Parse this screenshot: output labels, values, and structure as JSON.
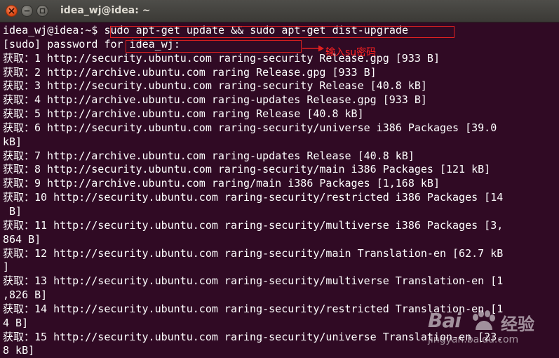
{
  "window": {
    "title": "idea_wj@idea: ~"
  },
  "terminal": {
    "lines": [
      "idea_wj@idea:~$ sudo apt-get update && sudo apt-get dist-upgrade",
      "[sudo] password for idea_wj:",
      "获取：1 http://security.ubuntu.com raring-security Release.gpg [933 B]",
      "获取：2 http://archive.ubuntu.com raring Release.gpg [933 B]",
      "获取：3 http://security.ubuntu.com raring-security Release [40.8 kB]",
      "获取：4 http://archive.ubuntu.com raring-updates Release.gpg [933 B]",
      "获取：5 http://archive.ubuntu.com raring Release [40.8 kB]",
      "获取：6 http://security.ubuntu.com raring-security/universe i386 Packages [39.0",
      "kB]",
      "获取：7 http://archive.ubuntu.com raring-updates Release [40.8 kB]",
      "获取：8 http://security.ubuntu.com raring-security/main i386 Packages [121 kB]",
      "获取：9 http://archive.ubuntu.com raring/main i386 Packages [1,168 kB]",
      "获取：10 http://security.ubuntu.com raring-security/restricted i386 Packages [14",
      " B]",
      "获取：11 http://security.ubuntu.com raring-security/multiverse i386 Packages [3,",
      "864 B]",
      "获取：12 http://security.ubuntu.com raring-security/main Translation-en [62.7 kB",
      "]",
      "获取：13 http://security.ubuntu.com raring-security/multiverse Translation-en [1",
      ",826 B]",
      "获取：14 http://security.ubuntu.com raring-security/restricted Translation-en [1",
      "4 B]",
      "获取：15 http://security.ubuntu.com raring-security/universe Translation-en [23.",
      "8 kB]"
    ]
  },
  "annotation": {
    "note": "输入su密码",
    "color": "#e02020"
  },
  "watermark": {
    "logo": "Bai",
    "logo2": "百",
    "jingyan": "经验",
    "url": "jingyan.baidu.com"
  },
  "icons": {
    "close": "close-icon",
    "minimize": "minimize-icon",
    "maximize": "maximize-icon"
  }
}
